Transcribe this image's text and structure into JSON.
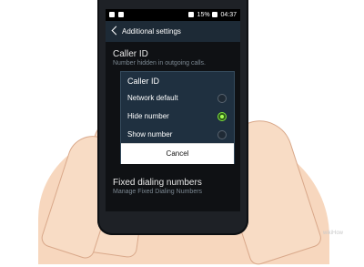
{
  "statusbar": {
    "battery_text": "15%",
    "time": "04:37"
  },
  "topbar": {
    "title": "Additional settings"
  },
  "settings_list": {
    "items": [
      {
        "title": "Caller ID",
        "subtitle": "Number hidden in outgoing calls."
      },
      {
        "title": "Fixed dialing numbers",
        "subtitle": "Manage Fixed Dialing Numbers"
      }
    ]
  },
  "dialog": {
    "title": "Caller ID",
    "options": [
      {
        "label": "Network default",
        "selected": false
      },
      {
        "label": "Hide number",
        "selected": true
      },
      {
        "label": "Show number",
        "selected": false
      }
    ],
    "cancel_label": "Cancel"
  },
  "watermark": {
    "text": "wikiHow"
  },
  "colors": {
    "selected_radio": "#7ee33b",
    "dialog_background": "#1f3040",
    "cancel_background": "#ffffff"
  }
}
